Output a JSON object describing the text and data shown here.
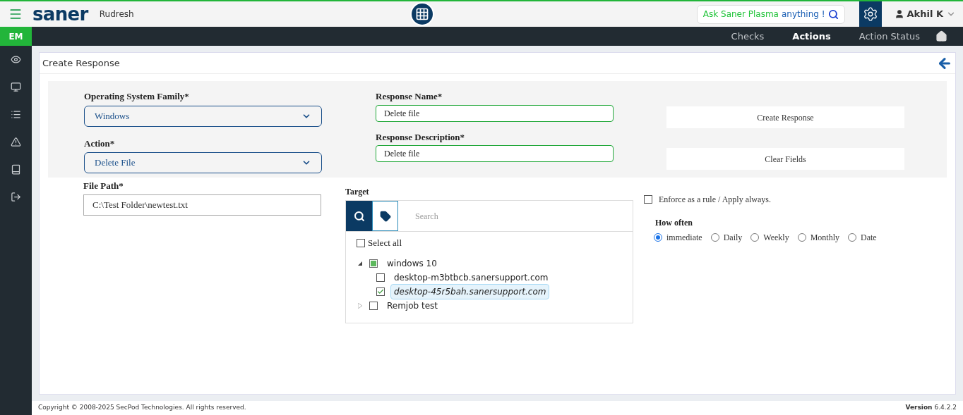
{
  "header": {
    "logo": "saner",
    "org": "Rudresh",
    "ask_prefix": "Ask Saner Plasma",
    "ask_suffix": "anything !",
    "user": "Akhil K"
  },
  "sidebar": {
    "badge": "EM",
    "items": [
      {
        "kind": "eye"
      },
      {
        "kind": "monitor"
      },
      {
        "kind": "list"
      },
      {
        "kind": "alert"
      },
      {
        "kind": "book"
      },
      {
        "kind": "logout"
      }
    ]
  },
  "nav": [
    {
      "label": "Checks",
      "selected": false
    },
    {
      "label": "Actions",
      "selected": true
    },
    {
      "label": "Action Status",
      "selected": false
    }
  ],
  "page_title": "Create Response",
  "form": {
    "os_label": "Operating System Family*",
    "os_value": "Windows",
    "action_label": "Action*",
    "action_value": "Delete File",
    "name_label": "Response Name*",
    "name_value": "Delete file",
    "desc_label": "Response Description*",
    "desc_value": "Delete file",
    "buttons": [
      "Create Response",
      "Clear Fields"
    ],
    "path_label": "File Path*",
    "path_value": "C:\\Test Folder\\newtest.txt"
  },
  "target": {
    "label": "Target",
    "search_placeholder": "Search",
    "select_all": {
      "label": "Select all",
      "checked": false
    },
    "tree": [
      {
        "label": "windows 10",
        "expanded": true,
        "checked": false,
        "indeterminate": true,
        "selected": false,
        "children": [
          {
            "label": "desktop-m3btbcb.sanersupport.com",
            "checked": false,
            "selected": false
          },
          {
            "label": "desktop-45r5bah.sanersupport.com",
            "checked": true,
            "selected": true
          }
        ]
      },
      {
        "label": "Remjob test",
        "expanded": false,
        "checked": false,
        "selected": false
      }
    ]
  },
  "enforce": {
    "label": "Enforce as a rule / Apply always.",
    "checked": false
  },
  "how_often": {
    "label": "How often",
    "options": [
      {
        "label": "immediate",
        "selected": true
      },
      {
        "label": "Daily",
        "selected": false
      },
      {
        "label": "Weekly",
        "selected": false
      },
      {
        "label": "Monthly",
        "selected": false
      },
      {
        "label": "Date",
        "selected": false
      }
    ]
  },
  "footer": {
    "copyright": "Copyright © 2008-2025 SecPod Technologies. All rights reserved.",
    "version_label": "Version",
    "version": "6.4.2.2"
  }
}
